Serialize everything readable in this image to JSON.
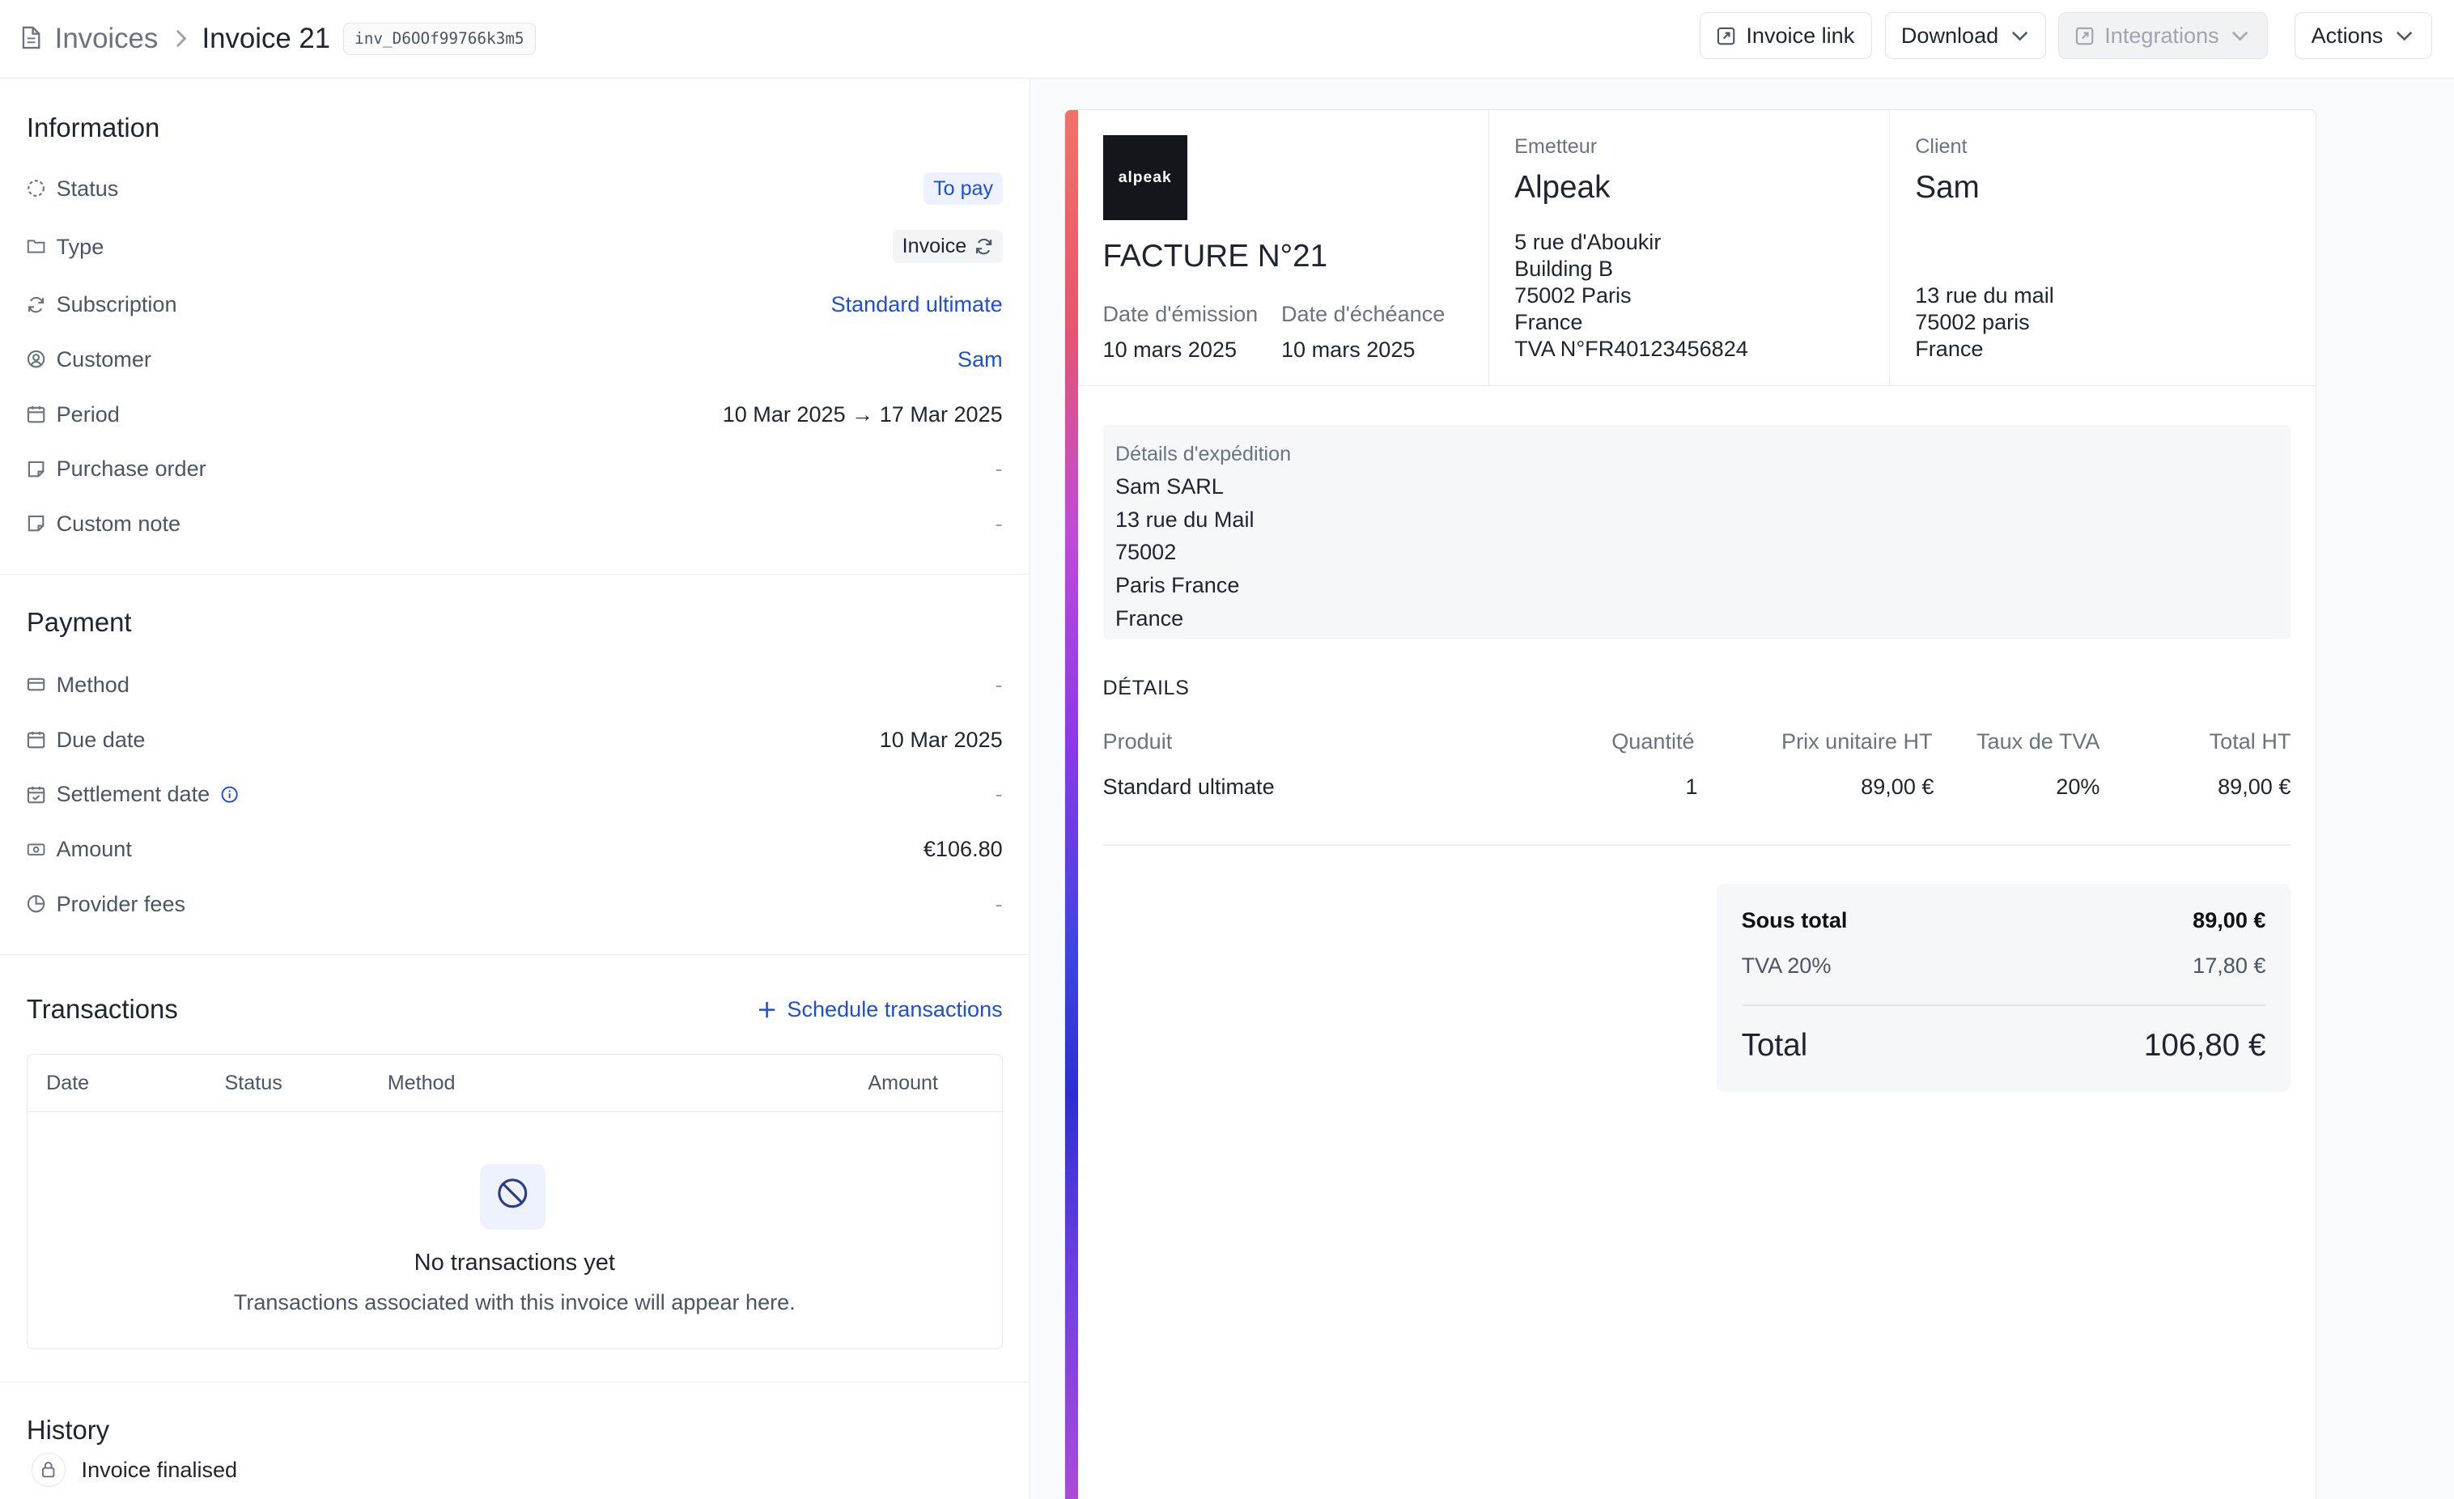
{
  "breadcrumb": {
    "parent": "Invoices",
    "current": "Invoice 21",
    "id_chip": "inv_D6OOf99766k3m5"
  },
  "toolbar": {
    "invoice_link": "Invoice link",
    "download": "Download",
    "integrations": "Integrations",
    "actions": "Actions"
  },
  "information": {
    "title": "Information",
    "status": {
      "label": "Status",
      "value": "To pay"
    },
    "type": {
      "label": "Type",
      "value": "Invoice"
    },
    "subscription": {
      "label": "Subscription",
      "value": "Standard ultimate"
    },
    "customer": {
      "label": "Customer",
      "value": "Sam"
    },
    "period": {
      "label": "Period",
      "value": "10 Mar 2025 → 17 Mar 2025"
    },
    "purchase_order": {
      "label": "Purchase order",
      "value": "-"
    },
    "custom_note": {
      "label": "Custom note",
      "value": "-"
    }
  },
  "payment": {
    "title": "Payment",
    "method": {
      "label": "Method",
      "value": "-"
    },
    "due_date": {
      "label": "Due date",
      "value": "10 Mar 2025"
    },
    "settlement_date": {
      "label": "Settlement date",
      "value": "-"
    },
    "amount": {
      "label": "Amount",
      "value": "€106.80"
    },
    "provider_fees": {
      "label": "Provider fees",
      "value": "-"
    }
  },
  "transactions": {
    "title": "Transactions",
    "schedule_label": "Schedule transactions",
    "columns": [
      "Date",
      "Status",
      "Method",
      "Amount"
    ],
    "empty_title": "No transactions yet",
    "empty_subtitle": "Transactions associated with this invoice will appear here."
  },
  "history": {
    "title": "History",
    "first_event": "Invoice finalised"
  },
  "invoice_doc": {
    "logo_text": "alpeak",
    "title": "FACTURE N°21",
    "issue_label": "Date d'émission",
    "issue_value": "10 mars 2025",
    "due_label": "Date d'échéance",
    "due_value": "10 mars 2025",
    "issuer": {
      "label": "Emetteur",
      "name": "Alpeak",
      "lines": [
        "5 rue d'Aboukir",
        "Building B",
        "75002 Paris",
        "France",
        "TVA N°FR40123456824"
      ]
    },
    "client": {
      "label": "Client",
      "name": "Sam",
      "lines": [
        "13 rue du mail",
        "75002 paris",
        "France"
      ]
    },
    "shipping": {
      "label": "Détails d'expédition",
      "lines": [
        "Sam SARL",
        "13 rue du Mail",
        "75002",
        "Paris France",
        "France"
      ]
    },
    "details_title": "DÉTAILS",
    "table_headers": [
      "Produit",
      "Quantité",
      "Prix unitaire HT",
      "Taux de TVA",
      "Total HT"
    ],
    "rows": [
      {
        "product": "Standard ultimate",
        "qty": "1",
        "unit": "89,00 €",
        "vat": "20%",
        "total": "89,00 €"
      }
    ],
    "subtotal_label": "Sous total",
    "subtotal_value": "89,00 €",
    "vat_label": "TVA 20%",
    "vat_value": "17,80 €",
    "total_label": "Total",
    "total_value": "106,80 €"
  },
  "colors": {
    "accent": "#1d4ed8",
    "stripe_top": "#f07367",
    "stripe_mid": "#3d45df"
  }
}
